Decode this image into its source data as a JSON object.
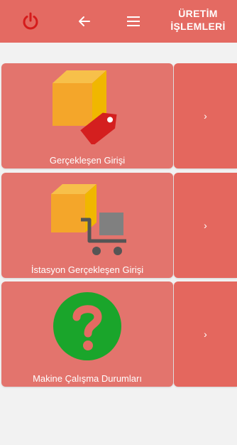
{
  "header": {
    "title_line1": "ÜRETİM",
    "title_line2": "İŞLEMLERİ",
    "bg_color": "#e46a62"
  },
  "menu": [
    {
      "label": "Gerçekleşen Girişi",
      "arrow": "›",
      "icon": "box-tag-icon"
    },
    {
      "label": "İstasyon Gerçekleşen Girişi",
      "arrow": "›",
      "icon": "box-cart-icon"
    },
    {
      "label": "Makine Çalışma Durumları",
      "arrow": "›",
      "icon": "question-circle-icon"
    }
  ]
}
